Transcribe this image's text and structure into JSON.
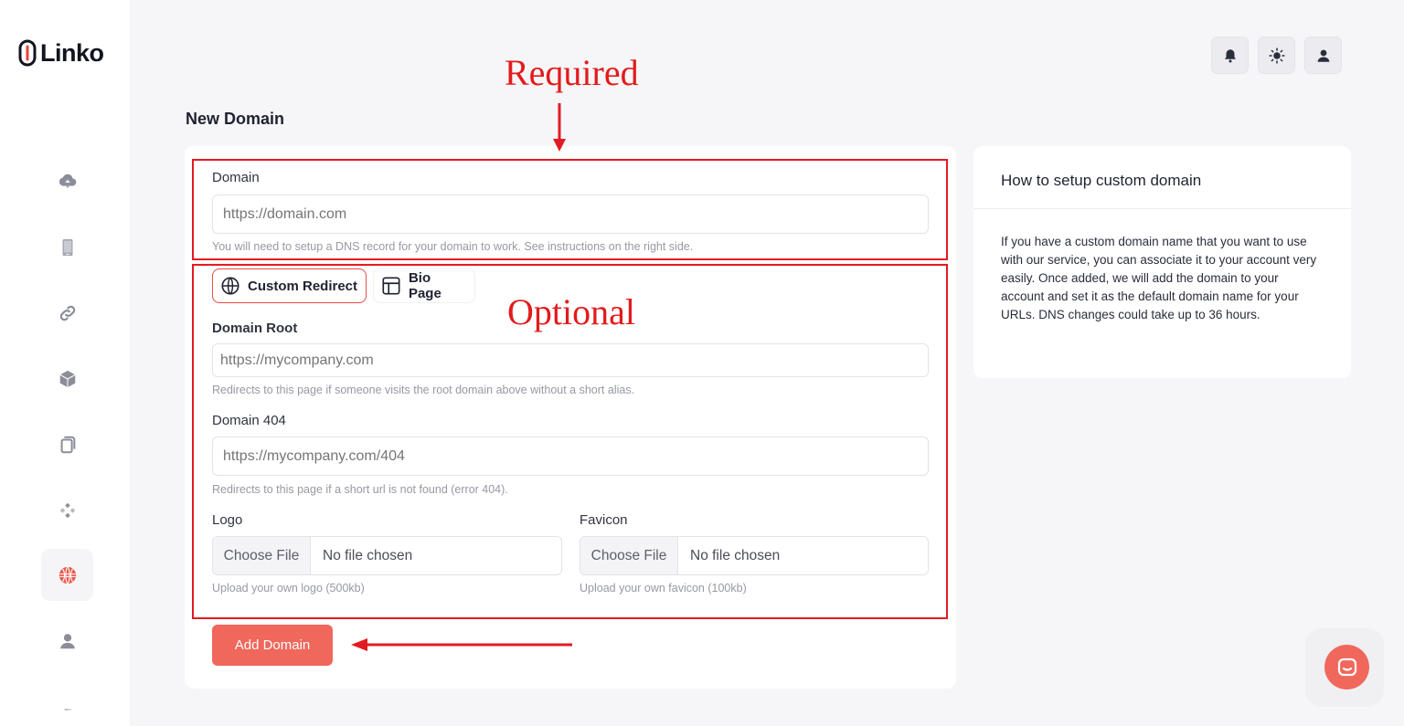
{
  "brand": {
    "name": "Linko"
  },
  "page": {
    "title": "New Domain"
  },
  "form": {
    "domain": {
      "label": "Domain",
      "placeholder": "https://domain.com",
      "help": "You will need to setup a DNS record for your domain to work. See instructions on the right side."
    },
    "tabs": [
      {
        "label": "Custom Redirect",
        "icon": "globe-icon",
        "active": true
      },
      {
        "label": "Bio Page",
        "icon": "layout-icon",
        "active": false
      }
    ],
    "domain_root": {
      "label": "Domain Root",
      "placeholder": "https://mycompany.com",
      "help": "Redirects to this page if someone visits the root domain above without a short alias."
    },
    "domain_404": {
      "label": "Domain 404",
      "placeholder": "https://mycompany.com/404",
      "help": "Redirects to this page if a short url is not found (error 404)."
    },
    "logo": {
      "label": "Logo",
      "button": "Choose File",
      "value": "No file chosen",
      "help": "Upload your own logo (500kb)"
    },
    "favicon": {
      "label": "Favicon",
      "button": "Choose File",
      "value": "No file chosen",
      "help": "Upload your own favicon (100kb)"
    },
    "submit_label": "Add Domain"
  },
  "info": {
    "title": "How to setup custom domain",
    "body": "If you have a custom domain name that you want to use with our service, you can associate it to your account very easily. Once added, we will add the domain to your account and set it as the default domain name for your URLs. DNS changes could take up to 36 hours."
  },
  "annotations": {
    "required": "Required",
    "optional": "Optional",
    "color": "#e21b23"
  },
  "sidebar": {
    "items": [
      {
        "icon": "cloud-upload-icon",
        "active": false
      },
      {
        "icon": "phone-icon",
        "active": false
      },
      {
        "icon": "link-icon",
        "active": false
      },
      {
        "icon": "box-icon",
        "active": false
      },
      {
        "icon": "copy-icon",
        "active": false
      },
      {
        "icon": "apps-icon",
        "active": false
      },
      {
        "icon": "globe-icon",
        "active": true
      },
      {
        "icon": "user-icon",
        "active": false
      },
      {
        "icon": "settings-icon",
        "active": false
      }
    ]
  },
  "header": {
    "actions": [
      "bell-icon",
      "sun-icon",
      "user-icon"
    ]
  },
  "colors": {
    "accent": "#f0675c",
    "active_icon": "#ea5a4e",
    "muted_icon": "#8b8e99"
  }
}
